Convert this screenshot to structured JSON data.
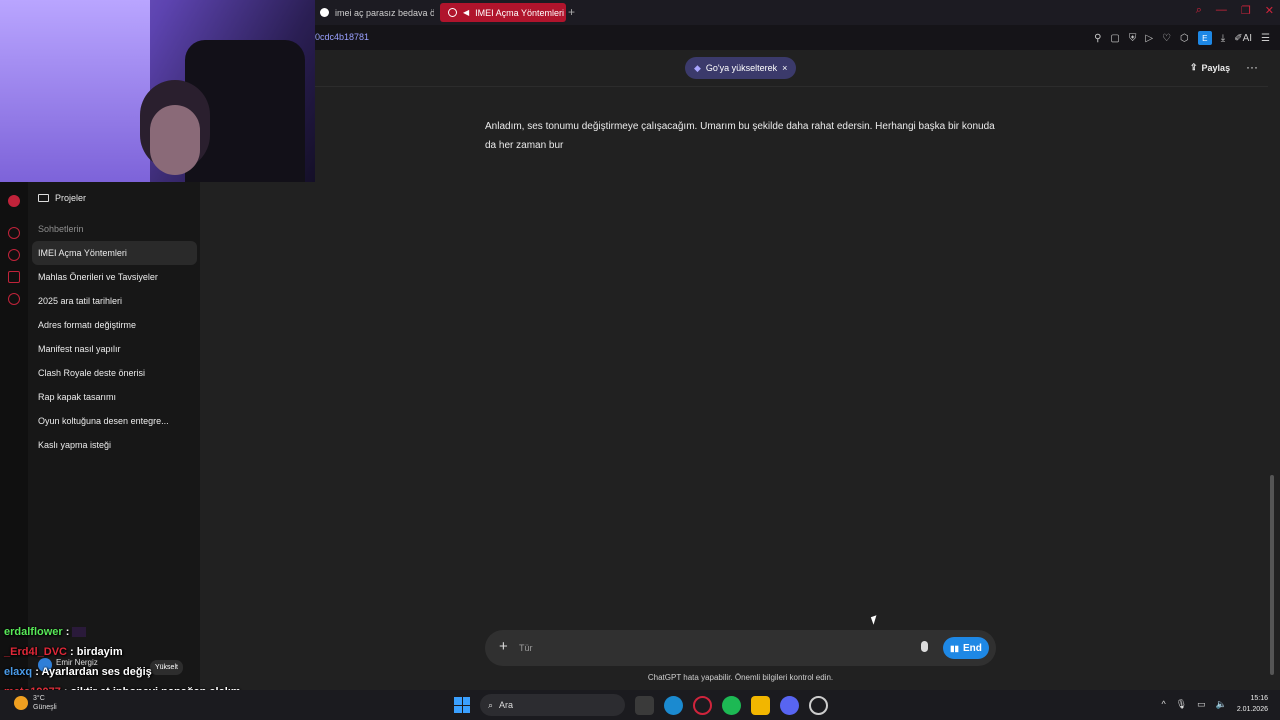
{
  "browser": {
    "tabs": [
      {
        "label": "imei aç parasız bedava öğrenme"
      },
      {
        "label": "IMEI Açma Yöntemleri"
      }
    ],
    "new_tab_icon": "+",
    "url": "0cdc4b18781",
    "extension_e": "E",
    "ai_label": "AI"
  },
  "sidebar": {
    "projects_label": "Projeler",
    "chats_header": "Sohbetlerin",
    "chats": [
      {
        "label": "IMEI Açma Yöntemleri"
      },
      {
        "label": "Mahlas Önerileri ve Tavsiyeler"
      },
      {
        "label": "2025 ara tatil tarihleri"
      },
      {
        "label": "Adres formatı değiştirme"
      },
      {
        "label": "Manifest nasıl yapılır"
      },
      {
        "label": "Clash Royale deste önerisi"
      },
      {
        "label": "Rap kapak tasarımı"
      },
      {
        "label": "Oyun koltuğuna desen entegre..."
      },
      {
        "label": "Kaslı yapma isteği"
      }
    ]
  },
  "header": {
    "upgrade_label": "Go'ya yükselterek",
    "upgrade_close": "×",
    "share_label": "Paylaş",
    "more_icon": "···"
  },
  "conversation": {
    "assistant_message": "Anladım, ses tonumu değiştirmeye çalışacağım. Umarım bu şekilde daha rahat edersin. Herhangi başka bir konuda da her zaman bur"
  },
  "composer": {
    "placeholder": "Tür",
    "value": "",
    "end_label": "End",
    "disclaimer": "ChatGPT hata yapabilir. Önemli bilgileri kontrol edin."
  },
  "stream_chat": [
    {
      "user": "erdalflower",
      "message": ""
    },
    {
      "user": "_Erd4l_DVC",
      "message": "birdayim"
    },
    {
      "user": "elaxq",
      "message": "Ayarlardan ses değiş"
    },
    {
      "user": "meto19077",
      "message": "siktir et iphoneyi papağan alalım"
    }
  ],
  "account": {
    "name": "Emir Nergiz",
    "upgrade_label": "Yükselt"
  },
  "taskbar": {
    "weather_temp": "3°C",
    "weather_desc": "Güneşli",
    "search_label": "Ara",
    "time": "15:16",
    "date": "2.01.2026"
  },
  "colors": {
    "accent_tab": "#b0142c",
    "end_button": "#1e88e5",
    "upgrade_pill": "#3b3a6b"
  }
}
